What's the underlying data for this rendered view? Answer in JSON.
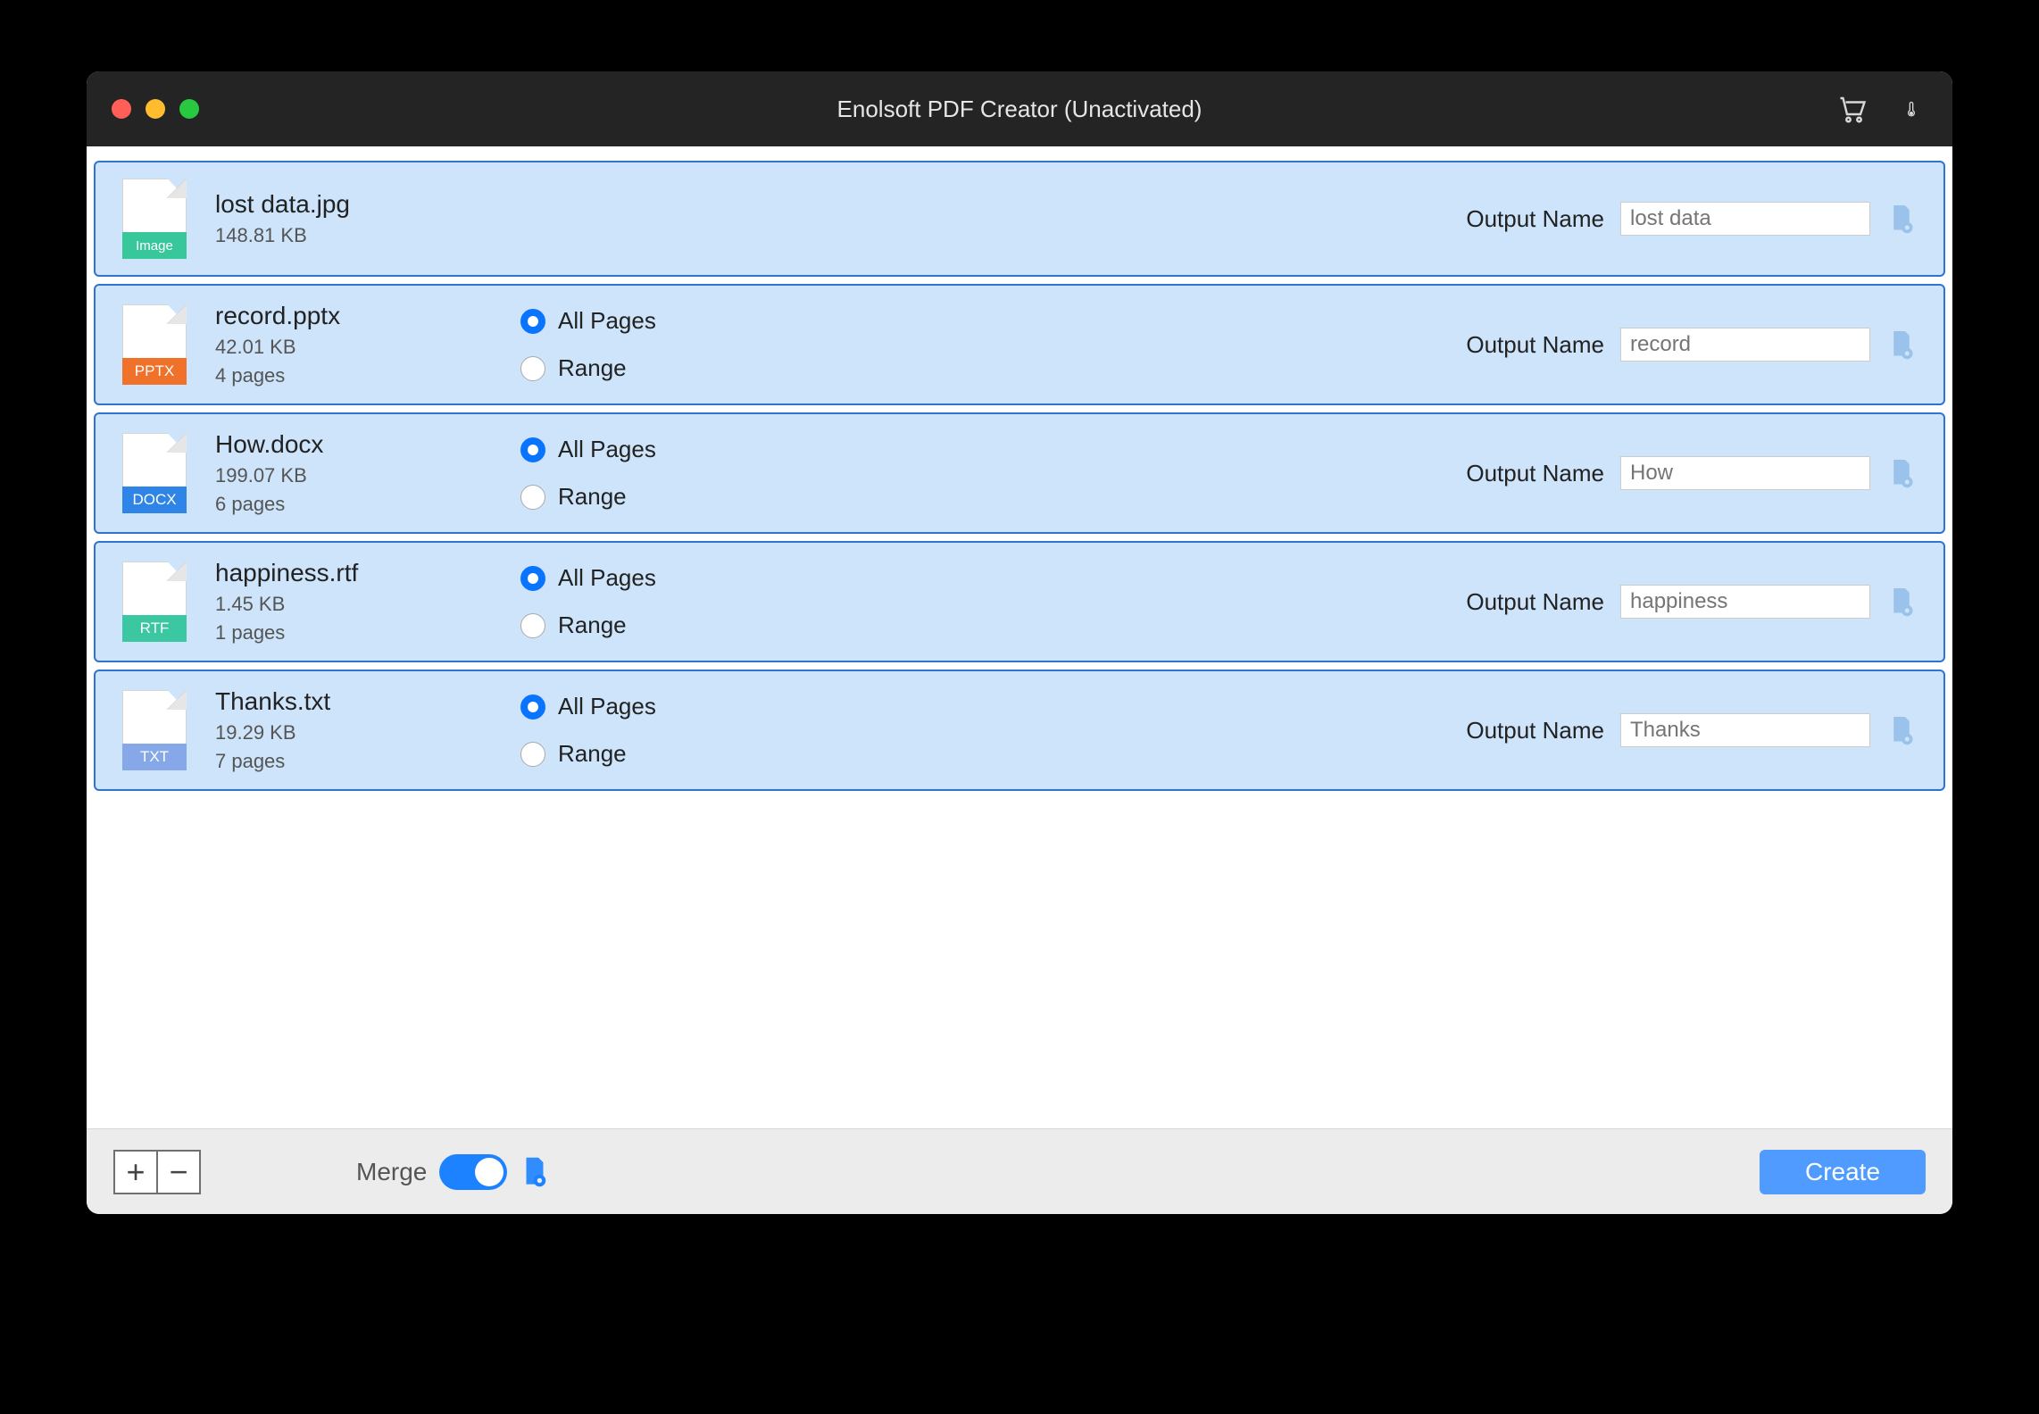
{
  "window": {
    "title": "Enolsoft PDF Creator (Unactivated)"
  },
  "labels": {
    "output_name": "Output Name",
    "all_pages": "All Pages",
    "range": "Range",
    "merge": "Merge",
    "create": "Create"
  },
  "files": [
    {
      "name": "lost data.jpg",
      "size": "148.81 KB",
      "pages": "",
      "badge": "Image",
      "badge_class": "image",
      "output": "lost data",
      "has_range": false
    },
    {
      "name": "record.pptx",
      "size": "42.01 KB",
      "pages": "4 pages",
      "badge": "PPTX",
      "badge_class": "pptx",
      "output": "record",
      "has_range": true
    },
    {
      "name": "How.docx",
      "size": "199.07 KB",
      "pages": "6 pages",
      "badge": "DOCX",
      "badge_class": "docx",
      "output": "How",
      "has_range": true
    },
    {
      "name": "happiness.rtf",
      "size": "1.45 KB",
      "pages": "1 pages",
      "badge": "RTF",
      "badge_class": "rtf",
      "output": "happiness",
      "has_range": true
    },
    {
      "name": "Thanks.txt",
      "size": "19.29 KB",
      "pages": "7 pages",
      "badge": "TXT",
      "badge_class": "txt",
      "output": "Thanks",
      "has_range": true
    }
  ]
}
